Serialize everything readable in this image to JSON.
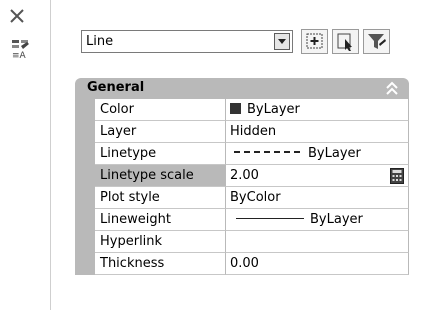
{
  "object_type": {
    "selected": "Line"
  },
  "section": {
    "title": "General"
  },
  "properties": [
    {
      "name": "Color",
      "value": "ByLayer"
    },
    {
      "name": "Layer",
      "value": "Hidden"
    },
    {
      "name": "Linetype",
      "value": "ByLayer"
    },
    {
      "name": "Linetype scale",
      "value": "2.00"
    },
    {
      "name": "Plot style",
      "value": "ByColor"
    },
    {
      "name": "Lineweight",
      "value": "ByLayer"
    },
    {
      "name": "Hyperlink",
      "value": ""
    },
    {
      "name": "Thickness",
      "value": "0.00"
    }
  ],
  "icons": {
    "close": "close-icon",
    "properties": "properties-palette-icon",
    "dropdown": "chevron-down-icon",
    "toggle_pickadd": "toggle-pickadd-icon",
    "select_objects": "select-objects-icon",
    "quick_select": "quick-select-filter-icon",
    "collapse": "chevron-up-icon",
    "calculator": "calculator-icon"
  },
  "colors": {
    "header_gray": "#b9b9b9",
    "selected_row": "#b9b9b9"
  }
}
